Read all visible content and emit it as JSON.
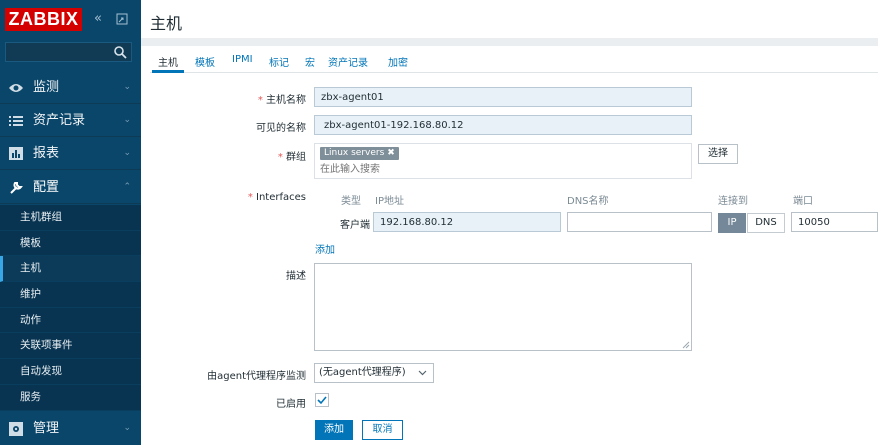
{
  "brand": {
    "logo_text": "ZABBIX",
    "collapse_icon": "«",
    "kiosk_icon": "⊡"
  },
  "sidebar": {
    "search": {
      "value": "",
      "placeholder": ""
    },
    "menu": [
      {
        "label": "监测",
        "icon": "eye-icon"
      },
      {
        "label": "资产记录",
        "icon": "list-icon"
      },
      {
        "label": "报表",
        "icon": "chart-icon"
      },
      {
        "label": "配置",
        "icon": "wrench-icon"
      },
      {
        "label": "管理",
        "icon": "admin-icon"
      }
    ],
    "submenu": [
      {
        "label": "主机群组"
      },
      {
        "label": "模板"
      },
      {
        "label": "主机",
        "active": true
      },
      {
        "label": "维护"
      },
      {
        "label": "动作"
      },
      {
        "label": "关联项事件"
      },
      {
        "label": "自动发现"
      },
      {
        "label": "服务"
      }
    ]
  },
  "page": {
    "title": "主机"
  },
  "tabs": [
    "主机",
    "模板",
    "IPMI",
    "标记",
    "宏",
    "资产记录",
    "加密"
  ],
  "form": {
    "host_name": {
      "label": "主机名称",
      "value": "zbx-agent01"
    },
    "visible_name": {
      "label": "可见的名称",
      "value": "zbx-agent01-192.168.80.12"
    },
    "groups": {
      "label": "群组",
      "chip": "Linux servers",
      "chip_remove": "✖",
      "placeholder": "在此输入搜索",
      "select_button": "选择"
    },
    "interfaces": {
      "label": "Interfaces",
      "headers": {
        "type": "类型",
        "ip": "IP地址",
        "dns": "DNS名称",
        "connect": "连接到",
        "port": "端口"
      },
      "row": {
        "type": "客户端",
        "ip": "192.168.80.12",
        "dns": "",
        "connect_ip": "IP",
        "connect_dns": "DNS",
        "port": "10050"
      },
      "add_link": "添加"
    },
    "description": {
      "label": "描述",
      "value": ""
    },
    "proxy": {
      "label": "由agent代理程序监测",
      "value": "(无agent代理程序)"
    },
    "enabled": {
      "label": "已启用",
      "checked": true
    },
    "buttons": {
      "add": "添加",
      "cancel": "取消"
    }
  },
  "colors": {
    "sidebar_bg": "#0a466a",
    "logo_red": "#d40000",
    "link_blue": "#0275b8",
    "required_red": "#e45959"
  }
}
